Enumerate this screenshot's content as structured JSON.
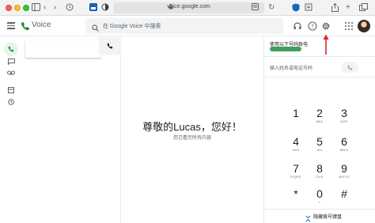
{
  "browser": {
    "url": "voice.google.com",
    "lock_icon": "lock-icon",
    "reader_icon": "reader-icon"
  },
  "app": {
    "name": "Voice",
    "search_placeholder": "在 Google Voice 中搜索"
  },
  "main": {
    "greeting": "尊敬的Lucas，您好！",
    "subtext": "您已看完所有内容"
  },
  "dialer": {
    "use_label": "使用以下号码致电",
    "number_placeholder": "输入姓名或电话号码",
    "keys": [
      {
        "digit": "1",
        "letters": ""
      },
      {
        "digit": "2",
        "letters": "ABC"
      },
      {
        "digit": "3",
        "letters": "DEF"
      },
      {
        "digit": "4",
        "letters": "GHI"
      },
      {
        "digit": "5",
        "letters": "JKL"
      },
      {
        "digit": "6",
        "letters": "MNO"
      },
      {
        "digit": "7",
        "letters": "PQRS"
      },
      {
        "digit": "8",
        "letters": "TUV"
      },
      {
        "digit": "9",
        "letters": "WXYZ"
      },
      {
        "digit": "*",
        "letters": ""
      },
      {
        "digit": "0",
        "letters": "+"
      },
      {
        "digit": "#",
        "letters": ""
      }
    ],
    "hide_keyboard_label": "隐藏拨号键盘"
  },
  "colors": {
    "accent_green": "#1e8e3e",
    "annotation_red": "#e3262b"
  }
}
